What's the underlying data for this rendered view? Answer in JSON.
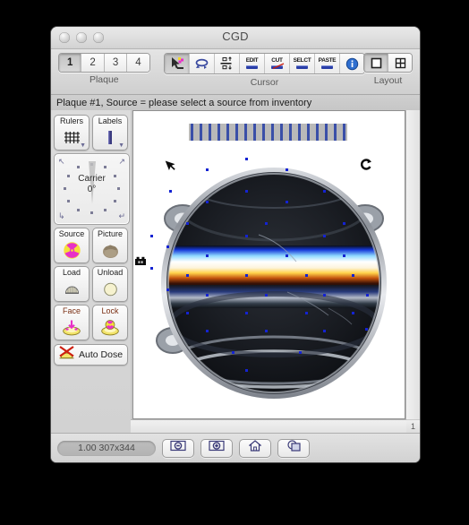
{
  "window": {
    "title": "CGD",
    "traffic_lights": [
      "close",
      "minimize",
      "zoom"
    ]
  },
  "toolbar": {
    "plaque": {
      "label": "Plaque",
      "buttons": [
        "1",
        "2",
        "3",
        "4"
      ],
      "selected": "1"
    },
    "cursor": {
      "label": "Cursor",
      "buttons": [
        {
          "name": "select-arrow-icon",
          "text": ""
        },
        {
          "name": "rotate-icon",
          "text": ""
        },
        {
          "name": "align-distribute-icon",
          "text": ""
        },
        {
          "name": "edit-icon",
          "text": "EDIT"
        },
        {
          "name": "cut-icon",
          "text": "CUT"
        },
        {
          "name": "select-icon",
          "text": "SELCT"
        },
        {
          "name": "paste-icon",
          "text": "PASTE"
        },
        {
          "name": "info-icon",
          "text": ""
        }
      ],
      "selected": "select-arrow-icon"
    },
    "layout": {
      "label": "Layout",
      "buttons": [
        "single-pane",
        "four-pane"
      ],
      "selected": "single-pane"
    }
  },
  "status": {
    "message": "Plaque #1, Source = please select a source from inventory"
  },
  "sidebar": {
    "rulers": {
      "label": "Rulers",
      "icon": "grid-icon",
      "has_menu": true
    },
    "labels": {
      "label": "Labels",
      "icon": "label-bar-icon",
      "has_menu": true
    },
    "carrier": {
      "label": "Carrier",
      "angle": "0°"
    },
    "source": {
      "label": "Source",
      "icon": "radioactive-trefoil-icon"
    },
    "picture": {
      "label": "Picture",
      "icon": "picture-blob-icon"
    },
    "load": {
      "label": "Load",
      "icon": "load-dome-icon"
    },
    "unload": {
      "label": "Unload",
      "icon": "unload-circle-icon"
    },
    "face": {
      "label": "Face",
      "icon": "face-dish-icon"
    },
    "lock": {
      "label": "Lock",
      "icon": "lock-dish-icon"
    },
    "auto_dose": {
      "label": "Auto Dose",
      "icon": "auto-dose-disabled-icon"
    }
  },
  "canvas": {
    "page_number": "1",
    "ruler_ticks": 18,
    "marker_count": 40,
    "cursor_glyphs": [
      {
        "name": "arrow-cursor",
        "char": "➤"
      },
      {
        "name": "rotate-cursor",
        "char": "C"
      },
      {
        "name": "anchor-marker",
        "char": "▬"
      }
    ]
  },
  "bottom_bar": {
    "zoom_info": "1.00 307x344",
    "buttons": [
      {
        "name": "zoom-out-button",
        "icon": "zoom-out-icon"
      },
      {
        "name": "zoom-in-button",
        "icon": "zoom-in-icon"
      },
      {
        "name": "home-button",
        "icon": "home-icon"
      },
      {
        "name": "duplicate-button",
        "icon": "duplicate-icon"
      }
    ]
  },
  "colors": {
    "marker_blue": "#1423d2",
    "ruler_blue": "#3a4fa8",
    "accent_magenta": "#e830c8",
    "accent_yellow": "#f5e03a",
    "red_x": "#cc1f10"
  }
}
